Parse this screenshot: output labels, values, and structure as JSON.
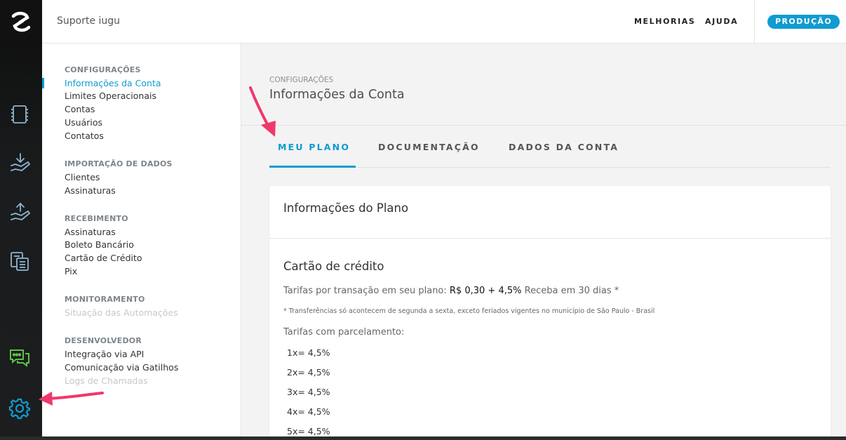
{
  "topbar": {
    "account_name": "Suporte iugu",
    "nav": [
      "MELHORIAS",
      "AJUDA"
    ],
    "environment": "PRODUÇÃO"
  },
  "rail": {
    "icons": [
      "logo-icon",
      "invoice-icon",
      "receive-icon",
      "send-icon",
      "calculator-icon",
      "chat-icon",
      "gear-icon"
    ]
  },
  "submenu": {
    "sections": [
      {
        "title": "CONFIGURAÇÕES",
        "items": [
          "Informações da Conta",
          "Limites Operacionais",
          "Contas",
          "Usuários",
          "Contatos"
        ]
      },
      {
        "title": "IMPORTAÇÃO DE DADOS",
        "items": [
          "Clientes",
          "Assinaturas"
        ]
      },
      {
        "title": "RECEBIMENTO",
        "items": [
          "Assinaturas",
          "Boleto Bancário",
          "Cartão de Crédito",
          "Pix"
        ]
      },
      {
        "title": "MONITORAMENTO",
        "items": [
          "Situação das Automações"
        ]
      },
      {
        "title": "DESENVOLVEDOR",
        "items": [
          "Integração via API",
          "Comunicação via Gatilhos",
          "Logs de Chamadas"
        ]
      }
    ]
  },
  "main": {
    "breadcrumb": "CONFIGURAÇÕES",
    "title": "Informações da Conta",
    "tabs": [
      "MEU PLANO",
      "DOCUMENTAÇÃO",
      "DADOS DA CONTA"
    ],
    "card": {
      "header": "Informações do Plano",
      "section_title": "Cartão de crédito",
      "fees_label": "Tarifas por transação em seu plano:",
      "fees_value": "R$ 0,30 + 4,5%",
      "fees_suffix": "Receba em 30 dias *",
      "note": "* Transferências só acontecem de segunda a sexta, exceto feriados vigentes no município de São Paulo - Brasil",
      "installments_label": "Tarifas com parcelamento:",
      "installments": [
        "1x= 4,5%",
        "2x= 4,5%",
        "3x= 4,5%",
        "4x= 4,5%",
        "5x= 4,5%"
      ]
    }
  },
  "colors": {
    "accent": "#109bd1",
    "annotation": "#f0386b",
    "chat": "#5cc24a"
  }
}
